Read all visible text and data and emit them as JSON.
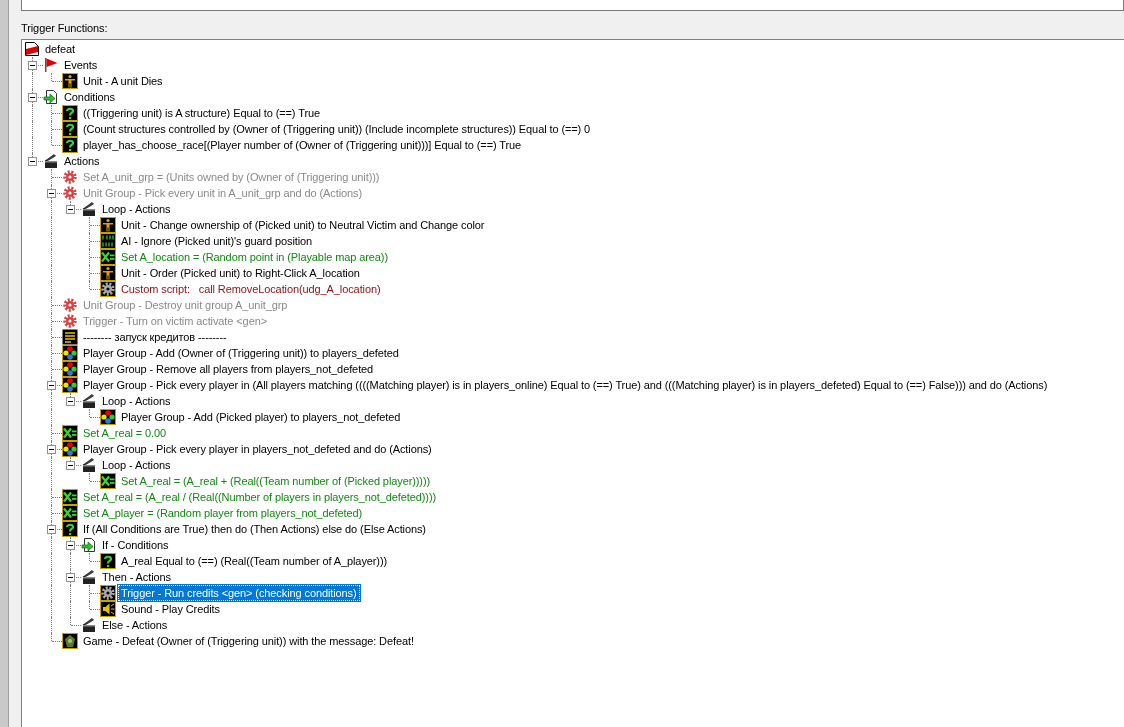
{
  "panel_label": "Trigger Functions:",
  "tree": {
    "label": "defeat",
    "kind": "trigger",
    "selected": false,
    "disabled": false,
    "children": [
      {
        "label": "Events",
        "kind": "event_group",
        "selected": false,
        "disabled": false,
        "expanded": true,
        "children": [
          {
            "label": "Unit - A unit Dies",
            "kind": "unit",
            "selected": false,
            "disabled": false
          }
        ]
      },
      {
        "label": "Conditions",
        "kind": "condition_group",
        "selected": false,
        "disabled": false,
        "expanded": true,
        "children": [
          {
            "label": "((Triggering unit) is A structure) Equal to (==) True",
            "kind": "condition",
            "selected": false,
            "disabled": false
          },
          {
            "label": "(Count structures controlled by (Owner of (Triggering unit)) (Include incomplete structures)) Equal to (==) 0",
            "kind": "condition",
            "selected": false,
            "disabled": false
          },
          {
            "label": "player_has_choose_race[(Player number of (Owner of (Triggering unit)))] Equal to (==) True",
            "kind": "condition",
            "selected": false,
            "disabled": false
          }
        ]
      },
      {
        "label": "Actions",
        "kind": "action_group",
        "selected": false,
        "disabled": false,
        "expanded": true,
        "children": [
          {
            "label": "Set A_unit_grp = (Units owned by (Owner of (Triggering unit)))",
            "selected": false,
            "disabled": true
          },
          {
            "label": "Unit Group - Pick every unit in A_unit_grp and do (Actions)",
            "selected": false,
            "disabled": true,
            "expanded": true,
            "children": [
              {
                "label": "Loop - Actions",
                "kind": "action_group",
                "selected": false,
                "disabled": false,
                "expanded": true,
                "children": [
                  {
                    "label": "Unit - Change ownership of (Picked unit) to Neutral Victim and Change color",
                    "kind": "unit",
                    "selected": false,
                    "disabled": false
                  },
                  {
                    "label": "AI - Ignore (Picked unit)'s guard position",
                    "kind": "ai",
                    "selected": false,
                    "disabled": false
                  },
                  {
                    "label": "Set A_location = (Random point in (Playable map area))",
                    "kind": "set_variable",
                    "selected": false,
                    "disabled": false
                  },
                  {
                    "label": "Unit - Order (Picked unit) to Right-Click A_location",
                    "kind": "unit",
                    "selected": false,
                    "disabled": false
                  },
                  {
                    "label": "Custom script:   call RemoveLocation(udg_A_location)",
                    "kind": "custom_script",
                    "selected": false,
                    "disabled": false
                  }
                ]
              }
            ]
          },
          {
            "label": "Unit Group - Destroy unit group A_unit_grp",
            "selected": false,
            "disabled": true
          },
          {
            "label": "Trigger - Turn on victim activate <gen>",
            "selected": false,
            "disabled": true
          },
          {
            "label": "-------- запуск кредитов --------",
            "kind": "comment",
            "selected": false,
            "disabled": false
          },
          {
            "label": "Player Group - Add (Owner of (Triggering unit)) to players_defeted",
            "kind": "player_group",
            "selected": false,
            "disabled": false
          },
          {
            "label": "Player Group - Remove all players from players_not_defeted",
            "kind": "player_group",
            "selected": false,
            "disabled": false
          },
          {
            "label": "Player Group - Pick every player in (All players matching ((((Matching player) is in players_online) Equal to (==) True) and (((Matching player) is in players_defeted) Equal to (==) False))) and do (Actions)",
            "kind": "player_group",
            "selected": false,
            "disabled": false,
            "expanded": true,
            "children": [
              {
                "label": "Loop - Actions",
                "kind": "action_group",
                "selected": false,
                "disabled": false,
                "expanded": true,
                "children": [
                  {
                    "label": "Player Group - Add (Picked player) to players_not_defeted",
                    "kind": "player_group",
                    "selected": false,
                    "disabled": false
                  }
                ]
              }
            ]
          },
          {
            "label": "Set A_real = 0.00",
            "kind": "set_variable",
            "selected": false,
            "disabled": false
          },
          {
            "label": "Player Group - Pick every player in players_not_defeted and do (Actions)",
            "kind": "player_group",
            "selected": false,
            "disabled": false,
            "expanded": true,
            "children": [
              {
                "label": "Loop - Actions",
                "kind": "action_group",
                "selected": false,
                "disabled": false,
                "expanded": true,
                "children": [
                  {
                    "label": "Set A_real = (A_real + (Real((Team number of (Picked player)))))",
                    "kind": "set_variable",
                    "selected": false,
                    "disabled": false
                  }
                ]
              }
            ]
          },
          {
            "label": "Set A_real = (A_real / (Real((Number of players in players_not_defeted))))",
            "kind": "set_variable",
            "selected": false,
            "disabled": false
          },
          {
            "label": "Set A_player = (Random player from players_not_defeted)",
            "kind": "set_variable",
            "selected": false,
            "disabled": false
          },
          {
            "label": "If (All Conditions are True) then do (Then Actions) else do (Else Actions)",
            "kind": "condition",
            "selected": false,
            "disabled": false,
            "expanded": true,
            "children": [
              {
                "label": "If - Conditions",
                "kind": "condition_group",
                "selected": false,
                "disabled": false,
                "expanded": true,
                "children": [
                  {
                    "label": "A_real Equal to (==) (Real((Team number of A_player)))",
                    "kind": "condition",
                    "selected": false,
                    "disabled": false
                  }
                ]
              },
              {
                "label": "Then - Actions",
                "kind": "action_group",
                "selected": false,
                "disabled": false,
                "expanded": true,
                "children": [
                  {
                    "label": "Trigger - Run credits <gen> (checking conditions)",
                    "kind": "trigger_action",
                    "selected": true,
                    "disabled": false
                  },
                  {
                    "label": "Sound - Play Credits",
                    "kind": "sound",
                    "selected": false,
                    "disabled": false
                  }
                ]
              },
              {
                "label": "Else - Actions",
                "kind": "action_group",
                "selected": false,
                "disabled": false
              }
            ]
          },
          {
            "label": "Game - Defeat (Owner of (Triggering unit)) with the message: Defeat!",
            "kind": "game",
            "selected": false,
            "disabled": false
          }
        ]
      }
    ]
  }
}
